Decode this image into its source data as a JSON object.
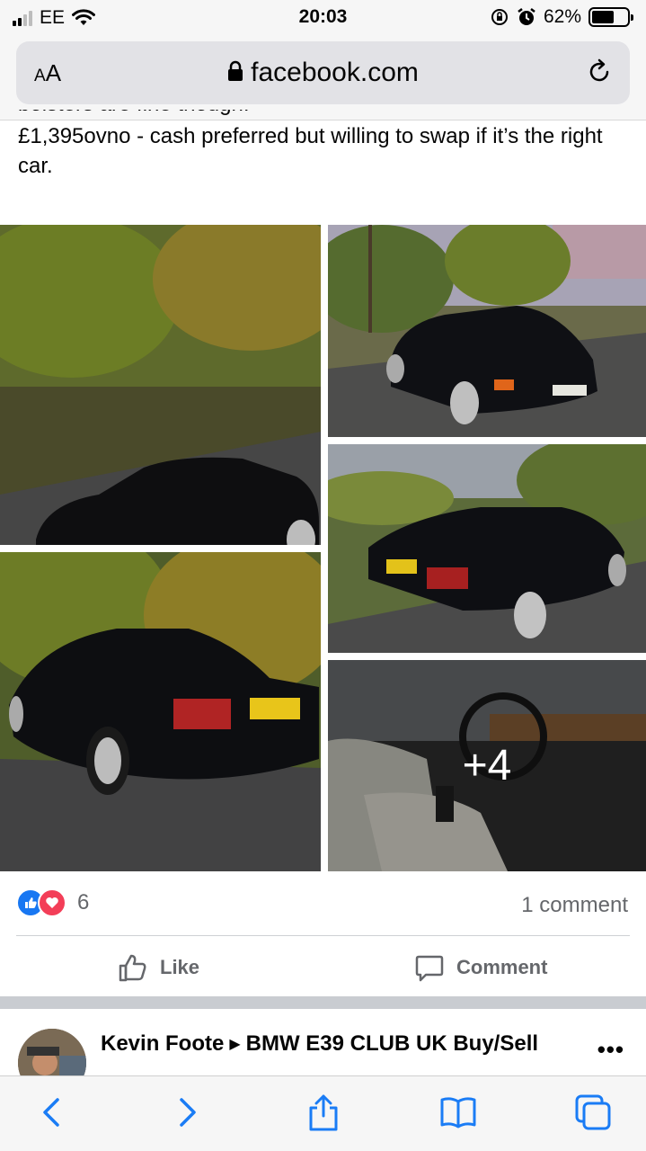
{
  "status_bar": {
    "carrier": "EE",
    "time": "20:03",
    "battery_percent": "62%",
    "battery_level": 0.62,
    "icons": [
      "signal-icon",
      "wifi-icon",
      "screen-rotation-lock-icon",
      "alarm-icon",
      "battery-icon"
    ]
  },
  "browser": {
    "text_size_label": "AA",
    "domain": "facebook.com",
    "icons": [
      "lock-icon",
      "reload-icon"
    ]
  },
  "post": {
    "clipped_text": "bolsters are fine though.",
    "text": "£1,395ovno - cash preferred but willing to swap if it’s the right car.",
    "photos": [
      {
        "alt": "Black BMW E39 front three-quarter view on leafy lane"
      },
      {
        "alt": "Black BMW E39 front view on country road"
      },
      {
        "alt": "Black BMW E39 rear three-quarter view"
      },
      {
        "alt": "Black BMW E39 rear view with number plate P821 RHV"
      },
      {
        "alt": "BMW E39 interior with grey seats and steering wheel"
      }
    ],
    "more_photos_label": "+4",
    "reaction_count": "6",
    "comments_label": "1 comment",
    "like_label": "Like",
    "comment_label": "Comment"
  },
  "next_post": {
    "author": "Kevin Foote",
    "group": "BMW E39 CLUB UK Buy/Sell",
    "more_label": "•••"
  },
  "toolbar": {
    "icons": [
      "back-icon",
      "forward-icon",
      "share-icon",
      "bookmarks-icon",
      "tabs-icon"
    ]
  }
}
